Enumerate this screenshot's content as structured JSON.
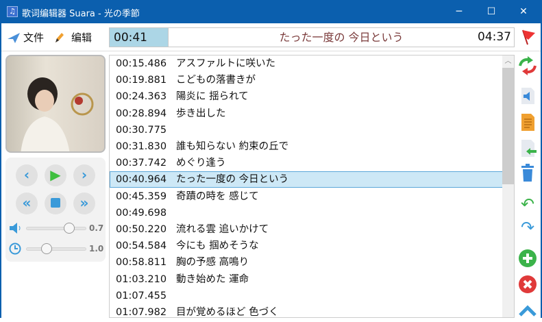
{
  "window": {
    "title": "歌词编辑器 Suara - 光の季節",
    "app_icon": "♫",
    "minimize": "─",
    "maximize": "☐",
    "close": "✕"
  },
  "menu": {
    "file": "文件",
    "edit": "编辑"
  },
  "player": {
    "current_time": "00:41",
    "current_lyric": "たった一度の 今日という",
    "total_time": "04:37",
    "volume": "0.7",
    "speed": "1.0",
    "volume_fraction": 0.7,
    "speed_fraction": 0.33
  },
  "lyrics": [
    {
      "time": "00:15.486",
      "text": "アスファルトに咲いた"
    },
    {
      "time": "00:19.881",
      "text": "こどもの落書きが"
    },
    {
      "time": "00:24.363",
      "text": "陽炎に 揺られて"
    },
    {
      "time": "00:28.894",
      "text": "歩き出した"
    },
    {
      "time": "00:30.775",
      "text": ""
    },
    {
      "time": "00:31.830",
      "text": "誰も知らない 約束の丘で"
    },
    {
      "time": "00:37.742",
      "text": "めぐり逢う"
    },
    {
      "time": "00:40.964",
      "text": "たった一度の 今日という",
      "selected": true
    },
    {
      "time": "00:45.359",
      "text": "奇蹟の時を 感じて"
    },
    {
      "time": "00:49.698",
      "text": ""
    },
    {
      "time": "00:50.220",
      "text": "流れる雲 追いかけて"
    },
    {
      "time": "00:54.584",
      "text": "今にも 掴めそうな"
    },
    {
      "time": "00:58.811",
      "text": "胸の予感 高鳴り"
    },
    {
      "time": "01:03.210",
      "text": "動き始めた 運命"
    },
    {
      "time": "01:07.455",
      "text": ""
    },
    {
      "time": "01:07.982",
      "text": "目が覚めるほど 色づく"
    }
  ],
  "colors": {
    "accent": "#0b5fae",
    "time_bg": "#acd6e6",
    "selected_bg": "#cde8f6"
  }
}
